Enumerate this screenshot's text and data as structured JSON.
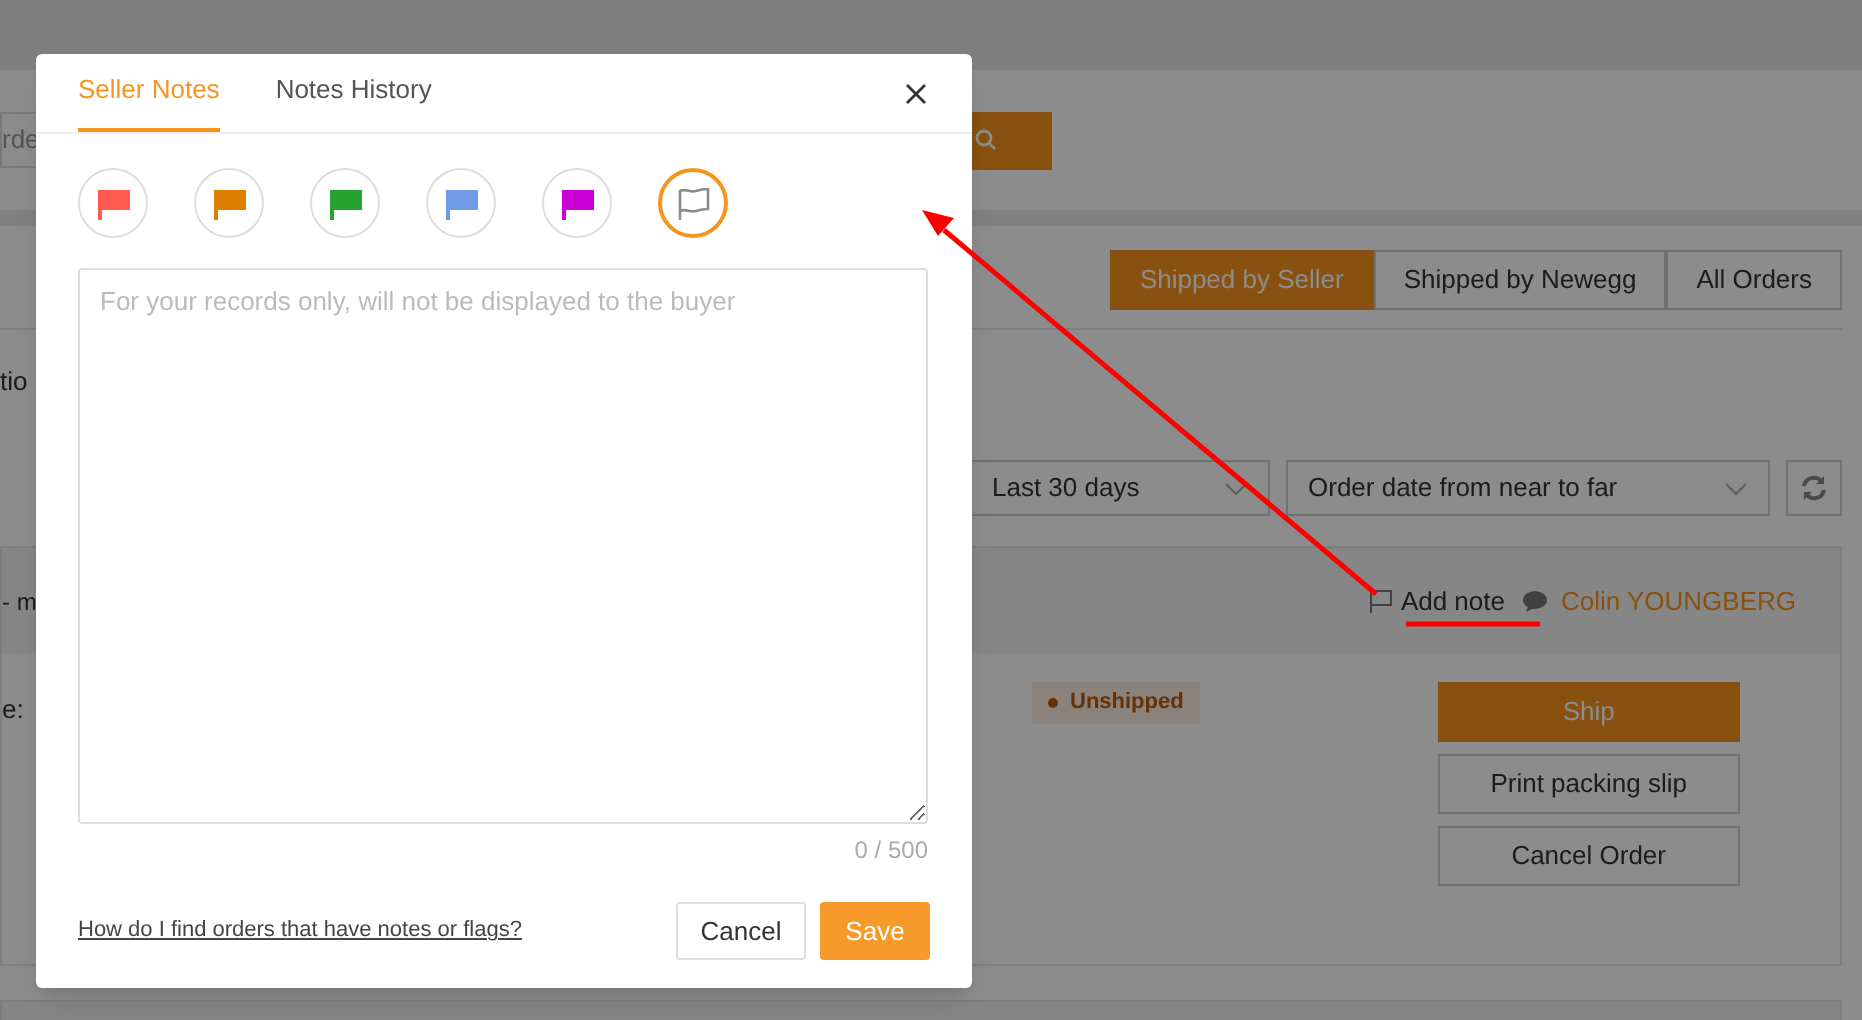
{
  "search": {
    "placeholder_fragment": "rde"
  },
  "order_tabs": [
    {
      "label": "Shipped by Seller",
      "selected": true
    },
    {
      "label": "Shipped by Newegg",
      "selected": false
    },
    {
      "label": "All Orders",
      "selected": false
    }
  ],
  "filter_fragment": "tio",
  "date_range": {
    "value": "Last 30 days"
  },
  "sort": {
    "value": "Order date from near to far"
  },
  "order": {
    "header_fragment": "- m",
    "add_note": "Add note",
    "buyer": "Colin YOUNGBERG",
    "body_fragment": "e:",
    "status": "Unshipped",
    "actions": [
      {
        "label": "Ship",
        "kind": "primary"
      },
      {
        "label": "Print packing slip",
        "kind": "secondary"
      },
      {
        "label": "Cancel Order",
        "kind": "secondary"
      }
    ]
  },
  "modal": {
    "tabs": [
      {
        "label": "Seller Notes",
        "selected": true
      },
      {
        "label": "Notes History",
        "selected": false
      }
    ],
    "flags": [
      {
        "kind": "filled",
        "color": "#ff5a4f",
        "selected": false
      },
      {
        "kind": "filled",
        "color": "#de7f00",
        "selected": false
      },
      {
        "kind": "filled",
        "color": "#27a334",
        "selected": false
      },
      {
        "kind": "filled",
        "color": "#6f9ae6",
        "selected": false
      },
      {
        "kind": "filled",
        "color": "#cc00d6",
        "selected": false
      },
      {
        "kind": "outline",
        "color": "#8c8c8c",
        "selected": true
      }
    ],
    "note_placeholder": "For your records only, will not be displayed to the buyer",
    "counter": "0 / 500",
    "help_link": "How do I find orders that have notes or flags?",
    "buttons": [
      {
        "label": "Cancel",
        "kind": "secondary"
      },
      {
        "label": "Save",
        "kind": "primary"
      }
    ]
  }
}
